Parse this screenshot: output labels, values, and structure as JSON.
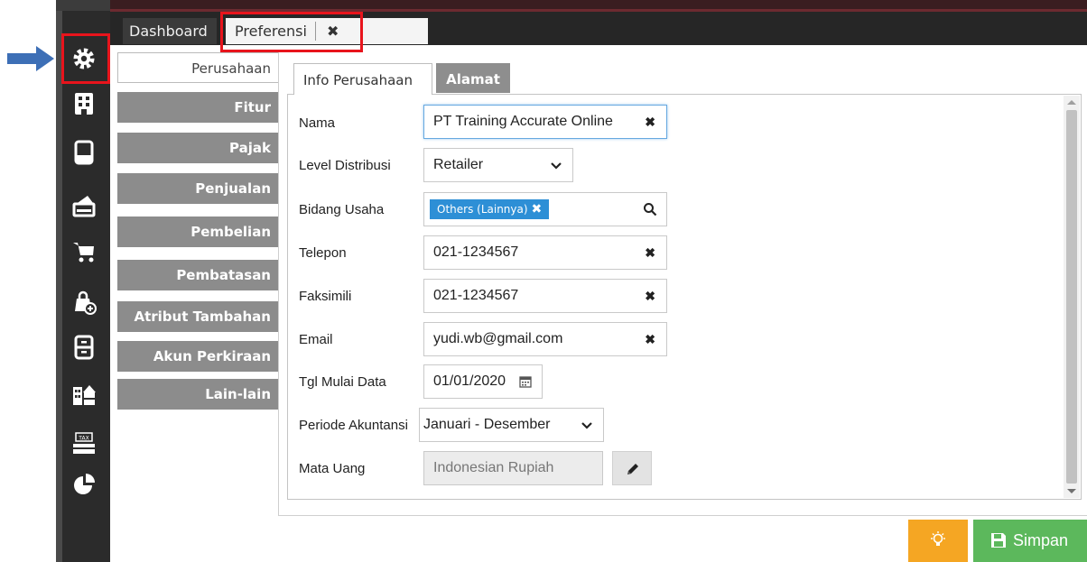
{
  "tabs": {
    "dashboard": "Dashboard",
    "preferensi": "Preferensi",
    "close_glyph": "✖"
  },
  "nav": [
    {
      "label": "Perusahaan",
      "active": true
    },
    {
      "label": "Fitur",
      "active": false
    },
    {
      "label": "Pajak",
      "active": false
    },
    {
      "label": "Penjualan",
      "active": false
    },
    {
      "label": "Pembelian",
      "active": false
    },
    {
      "label": "Pembatasan",
      "active": false
    },
    {
      "label": "Atribut Tambahan",
      "active": false
    },
    {
      "label": "Akun Perkiraan",
      "active": false
    },
    {
      "label": "Lain-lain",
      "active": false
    }
  ],
  "subtabs": {
    "info": "Info Perusahaan",
    "alamat": "Alamat"
  },
  "form": {
    "nama_label": "Nama",
    "nama_value": "PT Training Accurate Online",
    "level_label": "Level Distribusi",
    "level_value": "Retailer",
    "bidang_label": "Bidang Usaha",
    "bidang_tag": "Others (Lainnya)",
    "telepon_label": "Telepon",
    "telepon_value": "021-1234567",
    "faks_label": "Faksimili",
    "faks_value": "021-1234567",
    "email_label": "Email",
    "email_value": "yudi.wb@gmail.com",
    "tgl_label": "Tgl Mulai Data",
    "tgl_value": "01/01/2020",
    "periode_label": "Periode Akuntansi",
    "periode_value": "Januari - Desember",
    "mata_label": "Mata Uang",
    "mata_value": "Indonesian Rupiah"
  },
  "buttons": {
    "save": "Simpan"
  },
  "glyphs": {
    "clear": "✖",
    "chevron": "❯",
    "tag_remove": "✖"
  },
  "colors": {
    "accent_blue": "#2d8fd6",
    "save_green": "#5cb85c",
    "idea_orange": "#f5a623",
    "highlight_red": "#e8141c",
    "pointer_blue": "#3d6fb6"
  }
}
